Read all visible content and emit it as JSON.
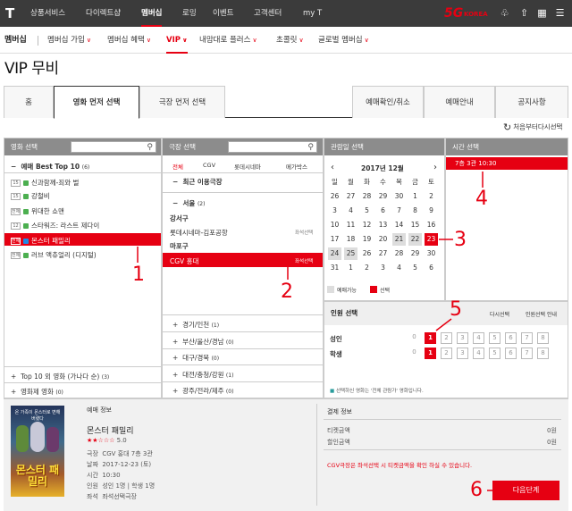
{
  "topbar": {
    "logo": "T",
    "nav": [
      "상품서비스",
      "다이렉트샵",
      "멤버십",
      "로밍",
      "이벤트",
      "고객센터",
      "my T"
    ],
    "brand": "5G",
    "brand_sub": "KOREA",
    "icons": [
      "bell-icon",
      "share-icon",
      "grid-icon",
      "menu-icon"
    ]
  },
  "subnav": {
    "brand": "멤버십",
    "items": [
      "멤버십 가입",
      "멤버십 혜택",
      "VIP",
      "내맘대로 플러스",
      "초콜릿",
      "글로벌 멤버십"
    ],
    "chev": "∨"
  },
  "page_title": "VIP 무비",
  "tabs": [
    "홈",
    "영화 먼저 선택",
    "극장 먼저 선택",
    "예매확인/취소",
    "예매안내",
    "공지사항"
  ],
  "reset_label": "처음부터다시선택",
  "movie_panel": {
    "title": "영화 선택",
    "group_toggle": "−",
    "group": "예매 Best Top 10",
    "group_count": "(6)",
    "movies": [
      {
        "age": "15",
        "name": "신과함께-죄와 벌"
      },
      {
        "age": "15",
        "name": "강철비"
      },
      {
        "age": "전체",
        "name": "위대한 쇼맨"
      },
      {
        "age": "12",
        "name": "스타워즈: 라스트 제다이"
      },
      {
        "age": "전체",
        "name": "몬스터 패밀리"
      },
      {
        "age": "전체",
        "name": "러브 액츄얼리 (디지털)"
      }
    ],
    "footer": [
      {
        "toggle": "+",
        "label": "Top 10 외 영화 (가나다 순)",
        "count": "(3)"
      },
      {
        "toggle": "+",
        "label": "영화제 영화",
        "count": "(0)"
      }
    ]
  },
  "theater_panel": {
    "title": "극장 선택",
    "filters": [
      "전체",
      "CGV",
      "롯데시네마",
      "메가박스"
    ],
    "recent": "최근 이용극장",
    "region": "서울",
    "region_count": "(2)",
    "groups": [
      {
        "name": "강서구",
        "items": [
          {
            "name": "롯데시네마-김포공항",
            "tag": "좌석선택"
          }
        ]
      },
      {
        "name": "마포구",
        "items": [
          {
            "name": "CGV 홍대",
            "tag": "좌석선택"
          }
        ]
      }
    ],
    "regions": [
      {
        "name": "경기/인천",
        "count": "(1)"
      },
      {
        "name": "부산/울산/경남",
        "count": "(0)"
      },
      {
        "name": "대구/경북",
        "count": "(0)"
      },
      {
        "name": "대전/충청/강원",
        "count": "(1)"
      },
      {
        "name": "광주/전라/제주",
        "count": "(0)"
      }
    ]
  },
  "calendar": {
    "title": "관람일 선택",
    "month": "2017년 12월",
    "prev": "‹",
    "next": "›",
    "weekdays": [
      "일",
      "월",
      "화",
      "수",
      "목",
      "금",
      "토"
    ],
    "weeks": [
      [
        "26",
        "27",
        "28",
        "29",
        "30",
        "1",
        "2"
      ],
      [
        "3",
        "4",
        "5",
        "6",
        "7",
        "8",
        "9"
      ],
      [
        "10",
        "11",
        "12",
        "13",
        "14",
        "15",
        "16"
      ],
      [
        "17",
        "18",
        "19",
        "20",
        "21",
        "22",
        "23"
      ],
      [
        "24",
        "25",
        "26",
        "27",
        "28",
        "29",
        "30"
      ],
      [
        "31",
        "1",
        "2",
        "3",
        "4",
        "5",
        "6"
      ]
    ],
    "legend_available": "예매가능",
    "legend_selected": "선택"
  },
  "time": {
    "title": "시간 선택",
    "slot": "7층 3관 10:30"
  },
  "people": {
    "title": "인원 선택",
    "reset": "다시선택",
    "guide": "인원선택 안내",
    "rows": [
      {
        "label": "성인",
        "nums": [
          "0",
          "1",
          "2",
          "3",
          "4",
          "5",
          "6",
          "7",
          "8"
        ]
      },
      {
        "label": "학생",
        "nums": [
          "0",
          "1",
          "2",
          "3",
          "4",
          "5",
          "6",
          "7",
          "8"
        ]
      }
    ],
    "note": "선택하신 영화는 '전체 관람가' 영화입니다."
  },
  "booking": {
    "title": "예매 정보",
    "movie": "몬스터 패밀리",
    "rating_text": "★★☆☆☆",
    "rating": "5.0",
    "poster_top": "온 가족이 몬스터로 변해버렸다",
    "poster_title": "몬스터 패밀리",
    "fields": [
      {
        "label": "극장",
        "value": "CGV 홍대 7층 3관"
      },
      {
        "label": "날짜",
        "value": "2017-12-23 (토)"
      },
      {
        "label": "시간",
        "value": "10:30"
      },
      {
        "label": "인원",
        "value": "성인 1명 | 학생 1명"
      },
      {
        "label": "좌석",
        "value": "좌석선택극장"
      }
    ]
  },
  "payment": {
    "title": "결제 정보",
    "ticket_label": "티켓금액",
    "ticket_value": "0원",
    "discount_label": "할인금액",
    "discount_value": "0원",
    "notice": "CGV극장은 좌석선택 시 티켓금액을 확인 하실 수 있습니다.",
    "next_button": "다음단계"
  },
  "annotations": [
    "1",
    "2",
    "3",
    "4",
    "5",
    "6"
  ],
  "colors": {
    "accent": "#e60012",
    "header": "#8c8c8c",
    "topbar": "#3b3b3b"
  }
}
